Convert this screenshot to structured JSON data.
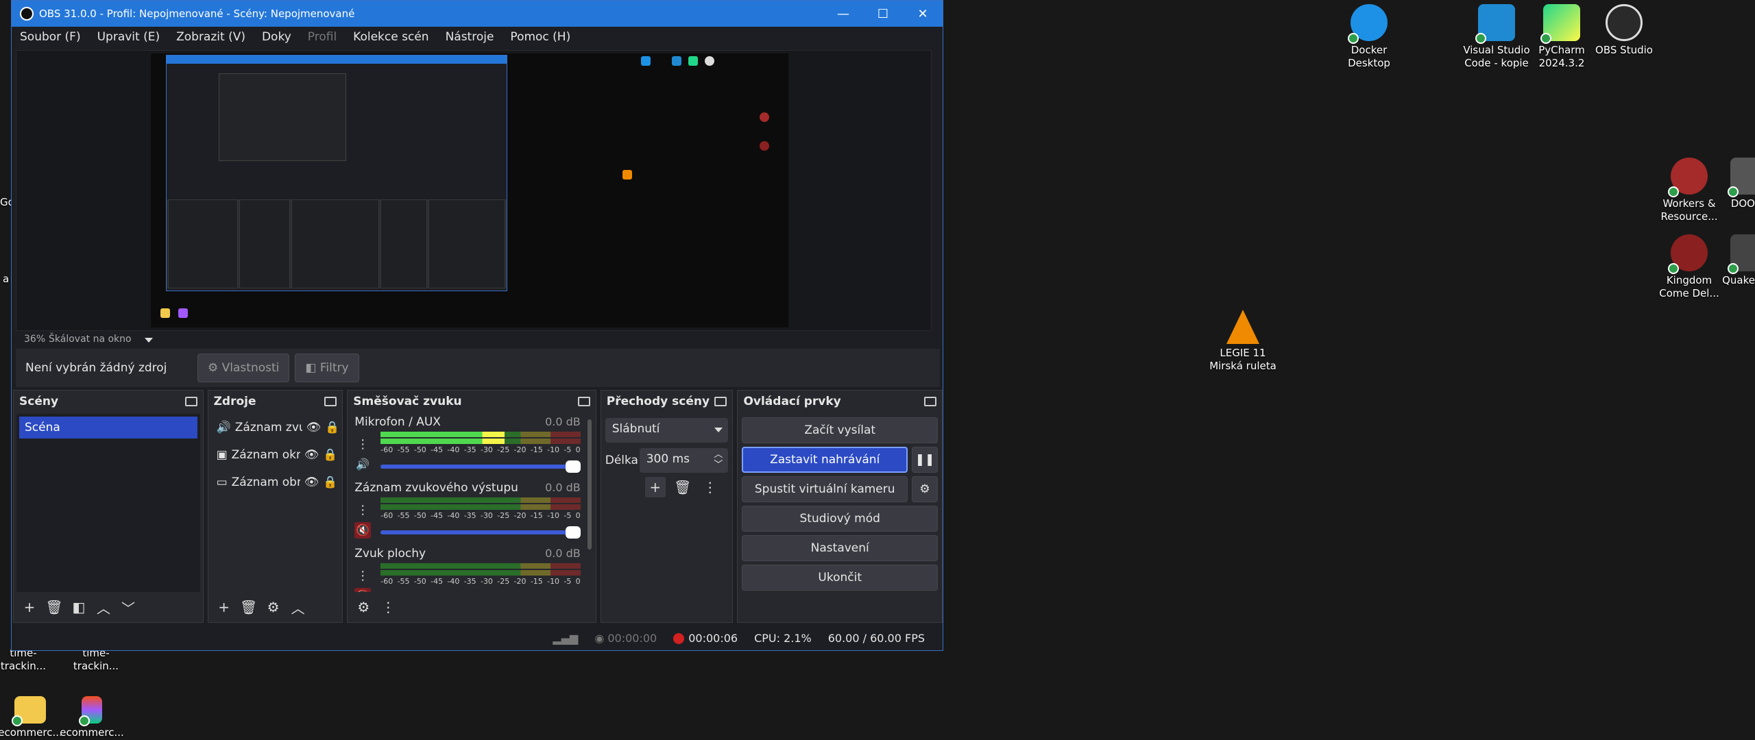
{
  "window": {
    "title": "OBS 31.0.0 - Profil: Nepojmenované - Scény: Nepojmenované",
    "minimize": "—",
    "maximize": "☐",
    "close": "✕"
  },
  "menu": [
    "Soubor (F)",
    "Upravit (E)",
    "Zobrazit (V)",
    "Doky",
    "Profil",
    "Kolekce scén",
    "Nástroje",
    "Pomoc (H)"
  ],
  "preview": {
    "zoom": "36%",
    "scale_mode": "Škálovat na okno"
  },
  "source_bar": {
    "no_source": "Není vybrán žádný zdroj",
    "properties": "Vlastnosti",
    "filters": "Filtry"
  },
  "scenes": {
    "title": "Scény",
    "items": [
      "Scéna"
    ]
  },
  "sources": {
    "title": "Zdroje",
    "items": [
      "Záznam zvu",
      "Záznam okr",
      "Záznam obr"
    ]
  },
  "mixer": {
    "title": "Směšovač zvuku",
    "ticks": [
      "-60",
      "-55",
      "-50",
      "-45",
      "-40",
      "-35",
      "-30",
      "-25",
      "-20",
      "-15",
      "-10",
      "-5",
      "0"
    ],
    "channels": [
      {
        "name": "Mikrofon / AUX",
        "db": "0.0 dB",
        "level": 0.62,
        "muted": false
      },
      {
        "name": "Záznam zvukového výstupu",
        "db": "0.0 dB",
        "level": 0,
        "muted": true
      },
      {
        "name": "Zvuk plochy",
        "db": "0.0 dB",
        "level": 0,
        "muted": true
      }
    ]
  },
  "transitions": {
    "title": "Přechody scény",
    "selected": "Slábnutí",
    "duration_label": "Délka",
    "duration": "300 ms"
  },
  "controls": {
    "title": "Ovládací prvky",
    "start_stream": "Začít vysílat",
    "stop_recording": "Zastavit nahrávání",
    "virtual_cam": "Spustit virtuální kameru",
    "studio_mode": "Studiový mód",
    "settings": "Nastavení",
    "exit": "Ukončit"
  },
  "status": {
    "stream_time": "00:00:00",
    "rec_time": "00:00:06",
    "cpu": "CPU: 2.1%",
    "fps": "60.00 / 60.00 FPS"
  },
  "desktop": {
    "icons": [
      {
        "label": "Docker Desktop",
        "color": "#1d91e6"
      },
      {
        "label": "Visual Studio Code - kopie",
        "color": "#1f8ad2"
      },
      {
        "label": "PyCharm 2024.3.2",
        "color": "#21d789"
      },
      {
        "label": "OBS Studio",
        "color": "#2a2a2a"
      },
      {
        "label": "Workers & Resource...",
        "color": "#a52a2a"
      },
      {
        "label": "DOO",
        "color": "#555"
      },
      {
        "label": "Kingdom Come Del...",
        "color": "#8b2020"
      },
      {
        "label": "Quake",
        "color": "#444"
      },
      {
        "label": "LEGIE 11 Mirská ruleta",
        "color": "#f08a00"
      },
      {
        "label": "time-trackin...",
        "color": "#333"
      },
      {
        "label": "time-trackin...",
        "color": "#333"
      },
      {
        "label": "ecommerc...",
        "color": "#f2c94c"
      },
      {
        "label": "ecommerc...",
        "color": "#a259ff"
      },
      {
        "label": "Go",
        "color": "#333"
      },
      {
        "label": "a",
        "color": "#333"
      }
    ]
  }
}
